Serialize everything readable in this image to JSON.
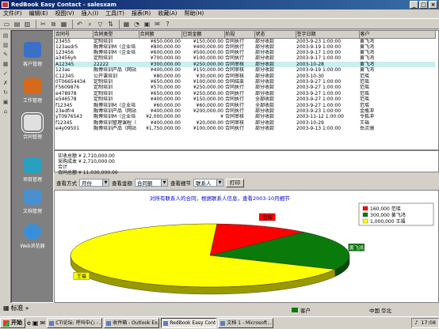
{
  "window": {
    "title": "RedBook Easy Contact - salesxam"
  },
  "menu": [
    "文件(F)",
    "编辑(E)",
    "视图(V)",
    "插入(I)",
    "工具(T)",
    "报表(R)",
    "收藏(A)",
    "帮助(H)"
  ],
  "nav": [
    {
      "label": "客户管理",
      "color": "#3a70c8",
      "icon": "person-icon"
    },
    {
      "label": "工作管理",
      "color": "#d66a1a",
      "icon": "tools-icon"
    },
    {
      "label": "合同管理",
      "color": "#e0e0e0",
      "icon": "contract-icon",
      "active": true
    },
    {
      "label": "项目管理",
      "color": "#2aa0c0",
      "icon": "project-icon"
    },
    {
      "label": "文档管理",
      "color": "#4a90d0",
      "icon": "docs-icon"
    },
    {
      "label": "Web浏览器",
      "color": "#3a90d8",
      "icon": "globe-icon"
    }
  ],
  "leftbottom": {
    "label": "标准"
  },
  "grid": {
    "headers": [
      "合同号",
      "合同类型",
      "合同额",
      "已到金额",
      "阶段",
      "状态",
      "签字日期",
      "客户"
    ],
    "rows": [
      [
        "23455",
        "定制培训",
        "¥650,000.00",
        "¥150,000.00",
        "合同执行",
        "部分收款",
        "2003-9-23 1:00:00",
        "黄飞鸿"
      ],
      [
        "123asdr5",
        "融博培训M（企业培",
        "¥800,000.00",
        "¥400,000.00",
        "合同执行",
        "部分收款",
        "2003-9-19 1:00:00",
        "黄飞鸿"
      ],
      [
        "123456",
        "融博培训M（企业培",
        "¥600,000.00",
        "¥500,000.00",
        "合同执行",
        "部分收款",
        "2003-9-17 1:00:00",
        "黄飞鸿"
      ],
      [
        "a3456yh",
        "定制培训",
        "¥700,000.00",
        "¥100,000.00",
        "合同执行",
        "部分收款",
        "2003-9-17 1:00:00",
        "黄飞鸿"
      ],
      [
        "A12345",
        "22222",
        "¥300,000.00",
        "¥250,000.00",
        "合同审核",
        "部分收款",
        "2003-10-28",
        "黄飞鸿"
      ],
      [
        "123as",
        "融博培训产品（网站",
        "¥400,000.00",
        "¥150,000.00",
        "合同审核",
        "部分收款",
        "2003-9-19 1:00:00",
        "黄飞鸿"
      ],
      [
        "C12345",
        "公开课培训",
        "¥80,000.00",
        "¥30,000.00",
        "合同审核",
        "部分收款",
        "2003-10-30",
        "范瑶"
      ],
      [
        "0T06654434",
        "定制培训",
        "¥650,000.00",
        "¥100,000.00",
        "合同结束",
        "部分收款",
        "2003-9-27 1:00:00",
        "范瑶"
      ],
      [
        "F5609876",
        "定制培训",
        "¥570,000.00",
        "¥250,000.00",
        "合同执行",
        "部分收款",
        "2003-9-27 1:00:00",
        "范瑶"
      ],
      [
        "e478978",
        "定制培训",
        "¥650,000.00",
        "¥250,000.00",
        "合同执行",
        "部分收款",
        "2003-9-27 1:00:00",
        "范瑶"
      ],
      [
        "e546578",
        "定制培训",
        "¥400,000.00",
        "¥150,000.00",
        "合同执行",
        "全部收款",
        "2003-9-27 1:00:00",
        "范瑶"
      ],
      [
        "f12345",
        "融博培训M（企业培",
        "¥60,000.00",
        "¥60,000.00",
        "合同执行",
        "全部收款",
        "2003-9-27 1:00:00",
        "范瑶"
      ],
      [
        "23edfr4",
        "融博培训产品（网站",
        "¥400,000.00",
        "¥200,000.00",
        "合同执行",
        "部分收款",
        "2003-9-23 1:00:00",
        "金瓶冲"
      ],
      [
        "yT0976543",
        "融博培训M（企业培",
        "¥2,000,000.00",
        "¥",
        "合同审核",
        "部分收款",
        "2003-11-12 1:00:00",
        "令狐冲"
      ],
      [
        "f12345",
        "融博培训管理课程（",
        "¥400,000.00",
        "¥20,000.00",
        "合同审核",
        "部分收款",
        "2003-10-29",
        "王福"
      ],
      [
        "e4y09501",
        "融博培训产品（网站",
        "¥1,750,000.00",
        "¥100,000.00",
        "合同执行",
        "部分收款",
        "2003-9-13 1:00:00",
        "岳灵珊"
      ]
    ],
    "selected_row": 4
  },
  "summary": [
    {
      "label": "实收总额",
      "value": "¥ 2,710,000.00"
    },
    {
      "label": "采购成本合计",
      "value": "¥ 2,710,000.00"
    },
    {
      "label": "合同总额",
      "value": "¥ 11,030,000.00"
    }
  ],
  "controls": {
    "view_label": "查看方式",
    "view_value": "月份",
    "view2_label": "查看金额",
    "view2_value": "合同额",
    "detail_label": "查看细节",
    "detail_value": "联系人",
    "print": "打印"
  },
  "chart_data": {
    "type": "pie",
    "title": "对所有联系人的合同，根据联系人信息，查看2003-10月细节",
    "slices": [
      {
        "label": "范瑶",
        "value": 160000,
        "color": "#ff0000",
        "legend": "160,000 范瑶"
      },
      {
        "label": "黄飞鸿",
        "value": 300000,
        "color": "#0a7a0a",
        "legend": "300,000 黄飞鸿"
      },
      {
        "label": "王福",
        "value": 1000000,
        "color": "#ffff00",
        "legend": "1,000,000 王福"
      }
    ]
  },
  "status": {
    "left": "客户",
    "right": "中国 华北"
  },
  "taskbar": {
    "start": "开始",
    "tasks": [
      "CTI论坛: 呼叫中心 - ...",
      "收件箱 - Outlook Ex...",
      "RedBook Easy Contact...",
      "文档 1 - Microsoft..."
    ],
    "active": 2,
    "clock": "17:08"
  }
}
